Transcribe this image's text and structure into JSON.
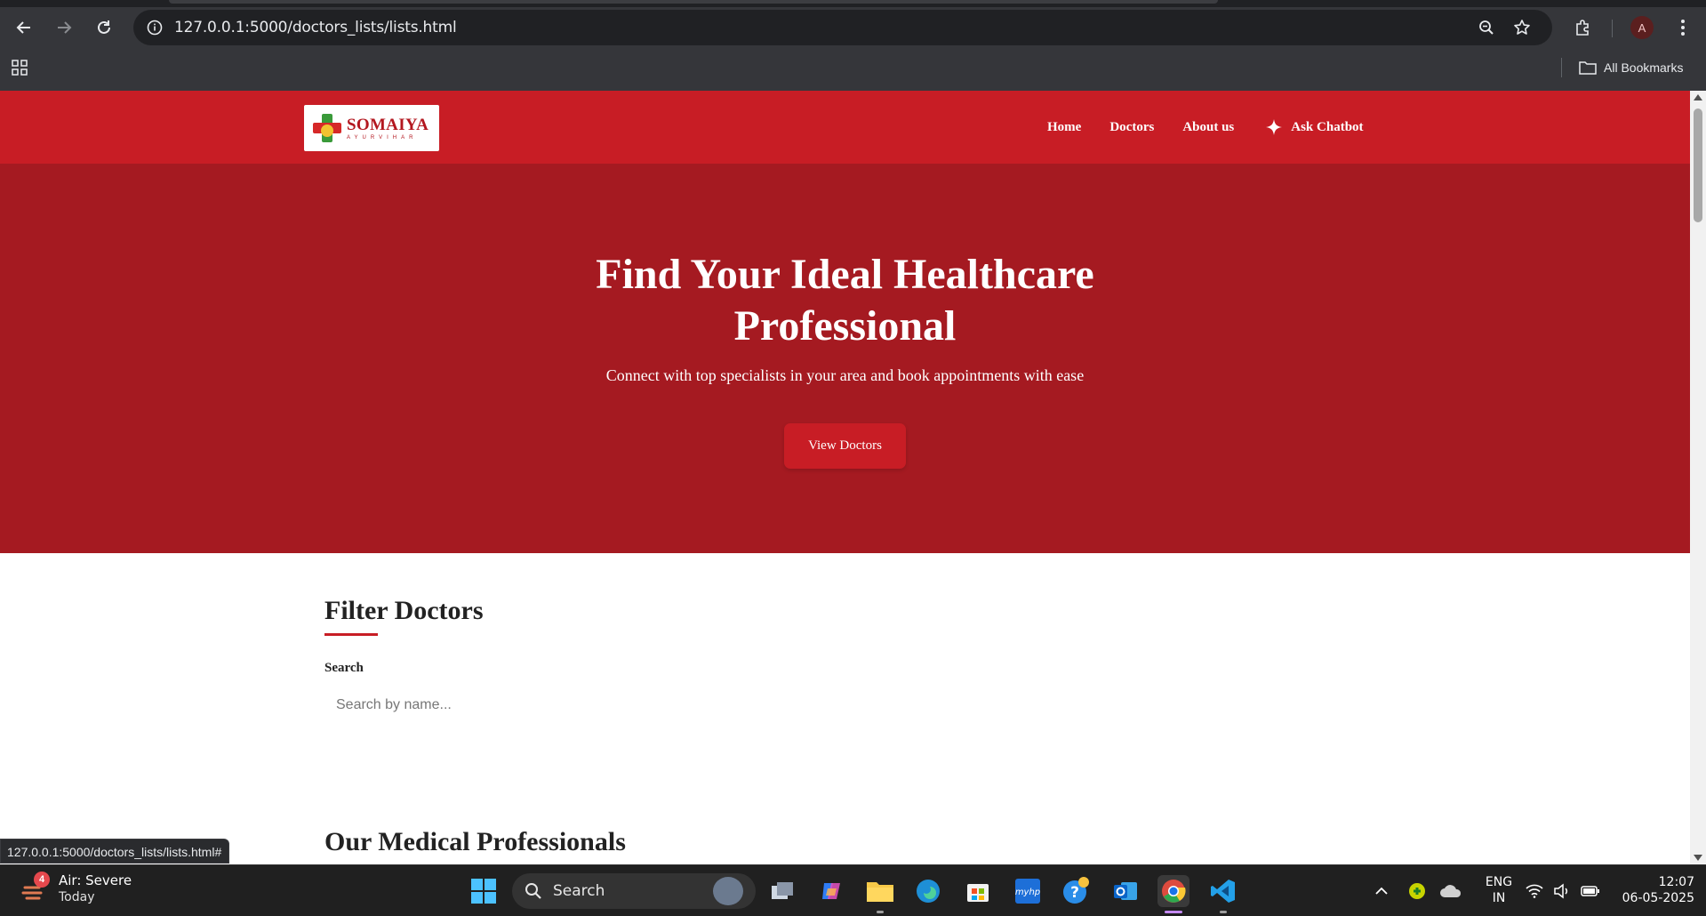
{
  "browser": {
    "url": "127.0.0.1:5000/doctors_lists/lists.html",
    "all_bookmarks": "All Bookmarks",
    "profile_initial": "A",
    "status_url": "127.0.0.1:5000/doctors_lists/lists.html#"
  },
  "site": {
    "logo_brand": "SOMAIYA",
    "logo_sub": "AYURVIHAR",
    "nav": [
      "Home",
      "Doctors",
      "About us"
    ],
    "chatbot_label": "Ask Chatbot"
  },
  "hero": {
    "title": "Find Your Ideal Healthcare Professional",
    "subtitle": "Connect with top specialists in your area and book appointments with ease",
    "button": "View Doctors"
  },
  "filter": {
    "title": "Filter Doctors",
    "search_label": "Search",
    "search_placeholder": "Search by name..."
  },
  "professionals_title": "Our Medical Professionals",
  "taskbar": {
    "weather_badge": "4",
    "weather_title": "Air: Severe",
    "weather_sub": "Today",
    "search_label": "Search",
    "lang_top": "ENG",
    "lang_bottom": "IN",
    "time": "12:07",
    "date": "06-05-2025"
  },
  "colors": {
    "header_red": "#c81d25",
    "hero_red": "#a51a21",
    "accent": "#c81d25"
  }
}
